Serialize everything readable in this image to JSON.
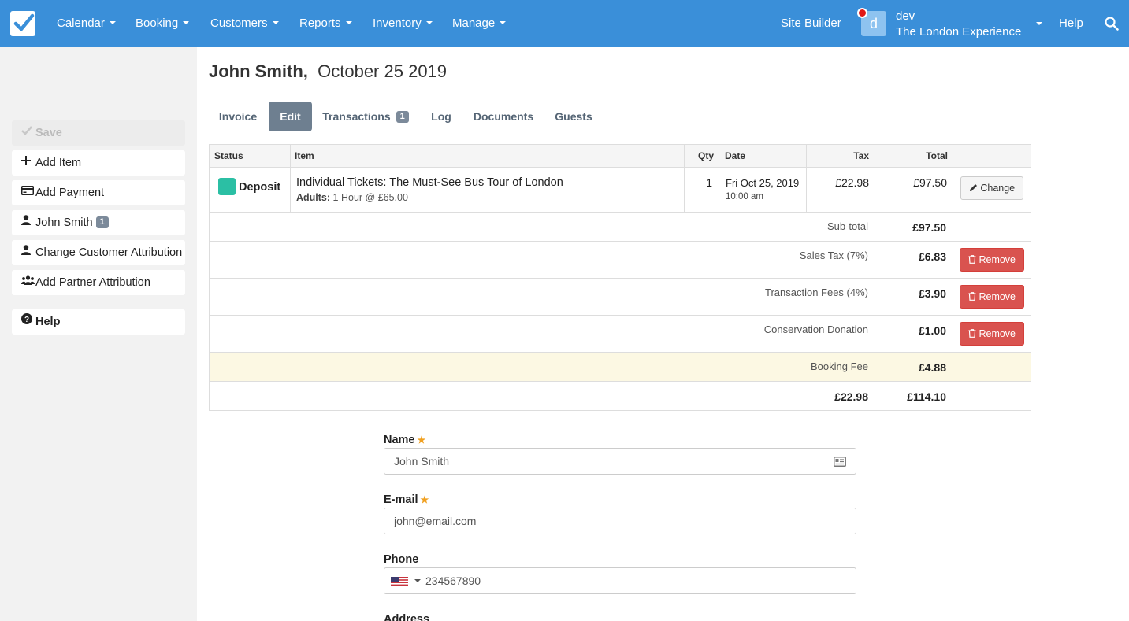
{
  "nav": {
    "items": [
      "Calendar",
      "Booking",
      "Customers",
      "Reports",
      "Inventory",
      "Manage"
    ],
    "site_builder": "Site Builder",
    "avatar_letter": "d",
    "user_name": "dev",
    "user_org": "The London Experience",
    "help": "Help"
  },
  "sidebar": {
    "save": "Save",
    "add_item": "Add Item",
    "add_payment": "Add Payment",
    "customer": "John Smith",
    "customer_badge": "1",
    "change_attr": "Change Customer Attribution",
    "partner_attr": "Add Partner Attribution",
    "help": "Help"
  },
  "page": {
    "customer_name": "John Smith,",
    "date": "October 25 2019"
  },
  "tabs": {
    "invoice": "Invoice",
    "edit": "Edit",
    "transactions": "Transactions",
    "transactions_badge": "1",
    "log": "Log",
    "documents": "Documents",
    "guests": "Guests"
  },
  "table": {
    "headers": {
      "status": "Status",
      "item": "Item",
      "qty": "Qty",
      "date": "Date",
      "tax": "Tax",
      "total": "Total"
    },
    "row": {
      "status": "Deposit",
      "item_title": "Individual Tickets: The Must-See Bus Tour of London",
      "item_detail_label": "Adults:",
      "item_detail": "1 Hour @ £65.00",
      "qty": "1",
      "date": "Fri Oct 25, 2019",
      "time": "10:00 am",
      "tax": "£22.98",
      "total": "£97.50",
      "change": "Change"
    },
    "subtotal": {
      "label": "Sub-total",
      "value": "£97.50"
    },
    "fees": [
      {
        "label": "Sales Tax (7%)",
        "value": "£6.83",
        "action": "Remove"
      },
      {
        "label": "Transaction Fees (4%)",
        "value": "£3.90",
        "action": "Remove"
      },
      {
        "label": "Conservation Donation",
        "value": "£1.00",
        "action": "Remove"
      }
    ],
    "booking_fee": {
      "label": "Booking Fee",
      "value": "£4.88"
    },
    "totals": {
      "tax": "£22.98",
      "total": "£114.10"
    }
  },
  "form": {
    "name_label": "Name",
    "name_value": "John Smith",
    "email_label": "E-mail",
    "email_value": "john@email.com",
    "phone_label": "Phone",
    "phone_value": "234567890",
    "address_label": "Address"
  },
  "colors": {
    "nav_bg": "#3a8fd9",
    "deposit": "#2bbfa4",
    "remove": "#d9534f",
    "booking_fee_bg": "#fcf8e3"
  }
}
